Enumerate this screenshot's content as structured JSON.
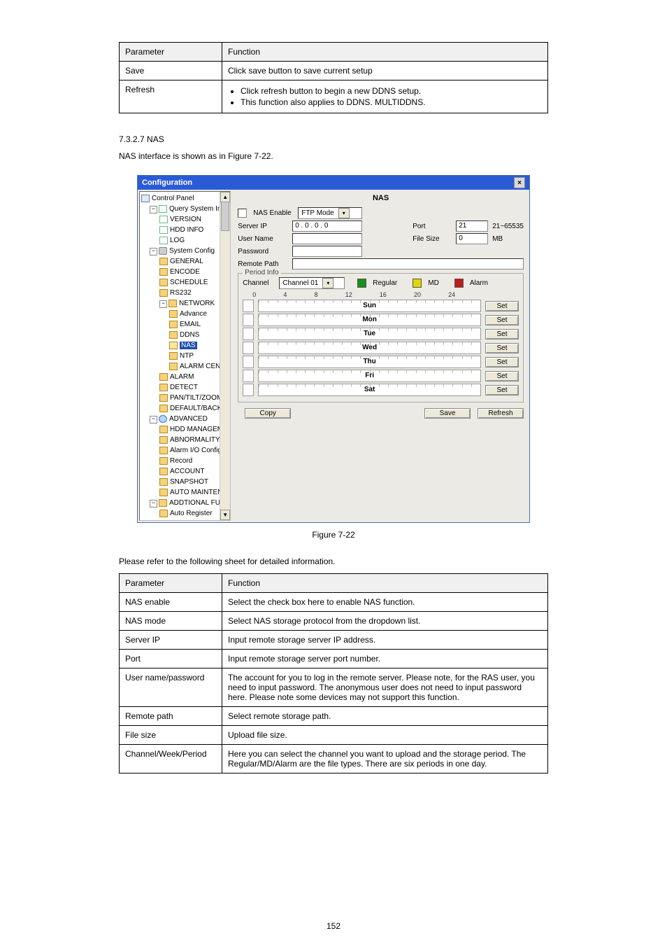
{
  "table1": {
    "headers": [
      "Parameter",
      "Function"
    ],
    "rows": [
      [
        "Save",
        "Click save button to save current setup"
      ],
      [
        "Refresh",
        {
          "bullets": [
            "Click refresh button to begin a new DDNS setup.",
            "This function also applies to DDNS. MULTIDDNS."
          ]
        }
      ]
    ]
  },
  "sectionTitle": "7.3.2.7 NAS",
  "sectionPara": "NAS interface is shown as in Figure 7-22.",
  "sectionPara2": "Please refer to the following sheet for detailed information.",
  "caption": "Figure 7-22",
  "screenshot": {
    "title": "Configuration",
    "tree": [
      {
        "label": "Control Panel",
        "ind": 0,
        "ico": "computer"
      },
      {
        "label": "Query System Info",
        "ind": 1,
        "ico": "page",
        "expandable": "-"
      },
      {
        "label": "VERSION",
        "ind": 2,
        "ico": "page"
      },
      {
        "label": "HDD INFO",
        "ind": 2,
        "ico": "page"
      },
      {
        "label": "LOG",
        "ind": 2,
        "ico": "page"
      },
      {
        "label": "System Config",
        "ind": 1,
        "ico": "tool",
        "expandable": "-"
      },
      {
        "label": "GENERAL",
        "ind": 2,
        "ico": "folder"
      },
      {
        "label": "ENCODE",
        "ind": 2,
        "ico": "folder"
      },
      {
        "label": "SCHEDULE",
        "ind": 2,
        "ico": "folder"
      },
      {
        "label": "RS232",
        "ind": 2,
        "ico": "folder"
      },
      {
        "label": "NETWORK",
        "ind": 2,
        "ico": "folder",
        "expandable": "-"
      },
      {
        "label": "Advance",
        "ind": 3,
        "ico": "folder"
      },
      {
        "label": "EMAIL",
        "ind": 3,
        "ico": "folder"
      },
      {
        "label": "DDNS",
        "ind": 3,
        "ico": "folder"
      },
      {
        "label": "NAS",
        "ind": 3,
        "ico": "folder-open",
        "selected": true
      },
      {
        "label": "NTP",
        "ind": 3,
        "ico": "folder"
      },
      {
        "label": "ALARM CENTER",
        "ind": 3,
        "ico": "folder"
      },
      {
        "label": "ALARM",
        "ind": 2,
        "ico": "folder"
      },
      {
        "label": "DETECT",
        "ind": 2,
        "ico": "folder"
      },
      {
        "label": "PAN/TILT/ZOOM",
        "ind": 2,
        "ico": "folder"
      },
      {
        "label": "DEFAULT/BACKUP",
        "ind": 2,
        "ico": "folder"
      },
      {
        "label": "ADVANCED",
        "ind": 1,
        "ico": "globe",
        "expandable": "-"
      },
      {
        "label": "HDD MANAGEMENT",
        "ind": 2,
        "ico": "folder"
      },
      {
        "label": "ABNORMALITY",
        "ind": 2,
        "ico": "folder"
      },
      {
        "label": "Alarm I/O Config",
        "ind": 2,
        "ico": "folder"
      },
      {
        "label": "Record",
        "ind": 2,
        "ico": "folder"
      },
      {
        "label": "ACCOUNT",
        "ind": 2,
        "ico": "folder"
      },
      {
        "label": "SNAPSHOT",
        "ind": 2,
        "ico": "folder"
      },
      {
        "label": "AUTO MAINTENANCE",
        "ind": 2,
        "ico": "folder"
      },
      {
        "label": "ADDTIONAL FUNCTION",
        "ind": 1,
        "ico": "folder",
        "expandable": "-"
      },
      {
        "label": "Auto Register",
        "ind": 2,
        "ico": "folder"
      }
    ],
    "panel": {
      "title": "NAS",
      "nasEnable": "NAS Enable",
      "ftpMode": "FTP Mode",
      "serverIp": "Server IP",
      "serverIpValue": "0 . 0 . 0 . 0",
      "port": "Port",
      "portValue": "21",
      "portNote": "21~65535",
      "userName": "User Name",
      "fileSize": "File Size",
      "fileSizeValue": "0",
      "mb": "MB",
      "password": "Password",
      "remotePath": "Remote Path",
      "periodInfo": "Period Info",
      "channel": "Channel",
      "channelValue": "Channel 01",
      "regular": "Regular",
      "md": "MD",
      "alarm": "Alarm",
      "rulerTicks": [
        "0",
        "4",
        "8",
        "12",
        "16",
        "20",
        "24"
      ],
      "days": [
        "Sun",
        "Mon",
        "Tue",
        "Wed",
        "Thu",
        "Fri",
        "Sat"
      ],
      "set": "Set",
      "copy": "Copy",
      "save": "Save",
      "refresh": "Refresh"
    }
  },
  "table2": {
    "headers": [
      "Parameter",
      "Function"
    ],
    "rows": [
      [
        "NAS enable",
        "Select the check box here to enable NAS function."
      ],
      [
        "NAS mode",
        "Select NAS storage protocol from the dropdown list."
      ],
      [
        "Server IP",
        "Input remote storage server IP address."
      ],
      [
        "Port",
        "Input remote storage server port number."
      ],
      [
        "User name/password",
        "The account for you to log in the remote server. Please note, for the RAS user, you need to input password. The anonymous user does not need to input password here. Please note some devices may not support this function."
      ],
      [
        "Remote path",
        "Select remote storage path."
      ],
      [
        "File size",
        "Upload file size."
      ],
      [
        "Channel/Week/Period",
        "Here you can select the channel you want to upload and the storage period. The Regular/MD/Alarm are the file types. There are six periods in one day."
      ]
    ]
  },
  "pageNumber": "152"
}
